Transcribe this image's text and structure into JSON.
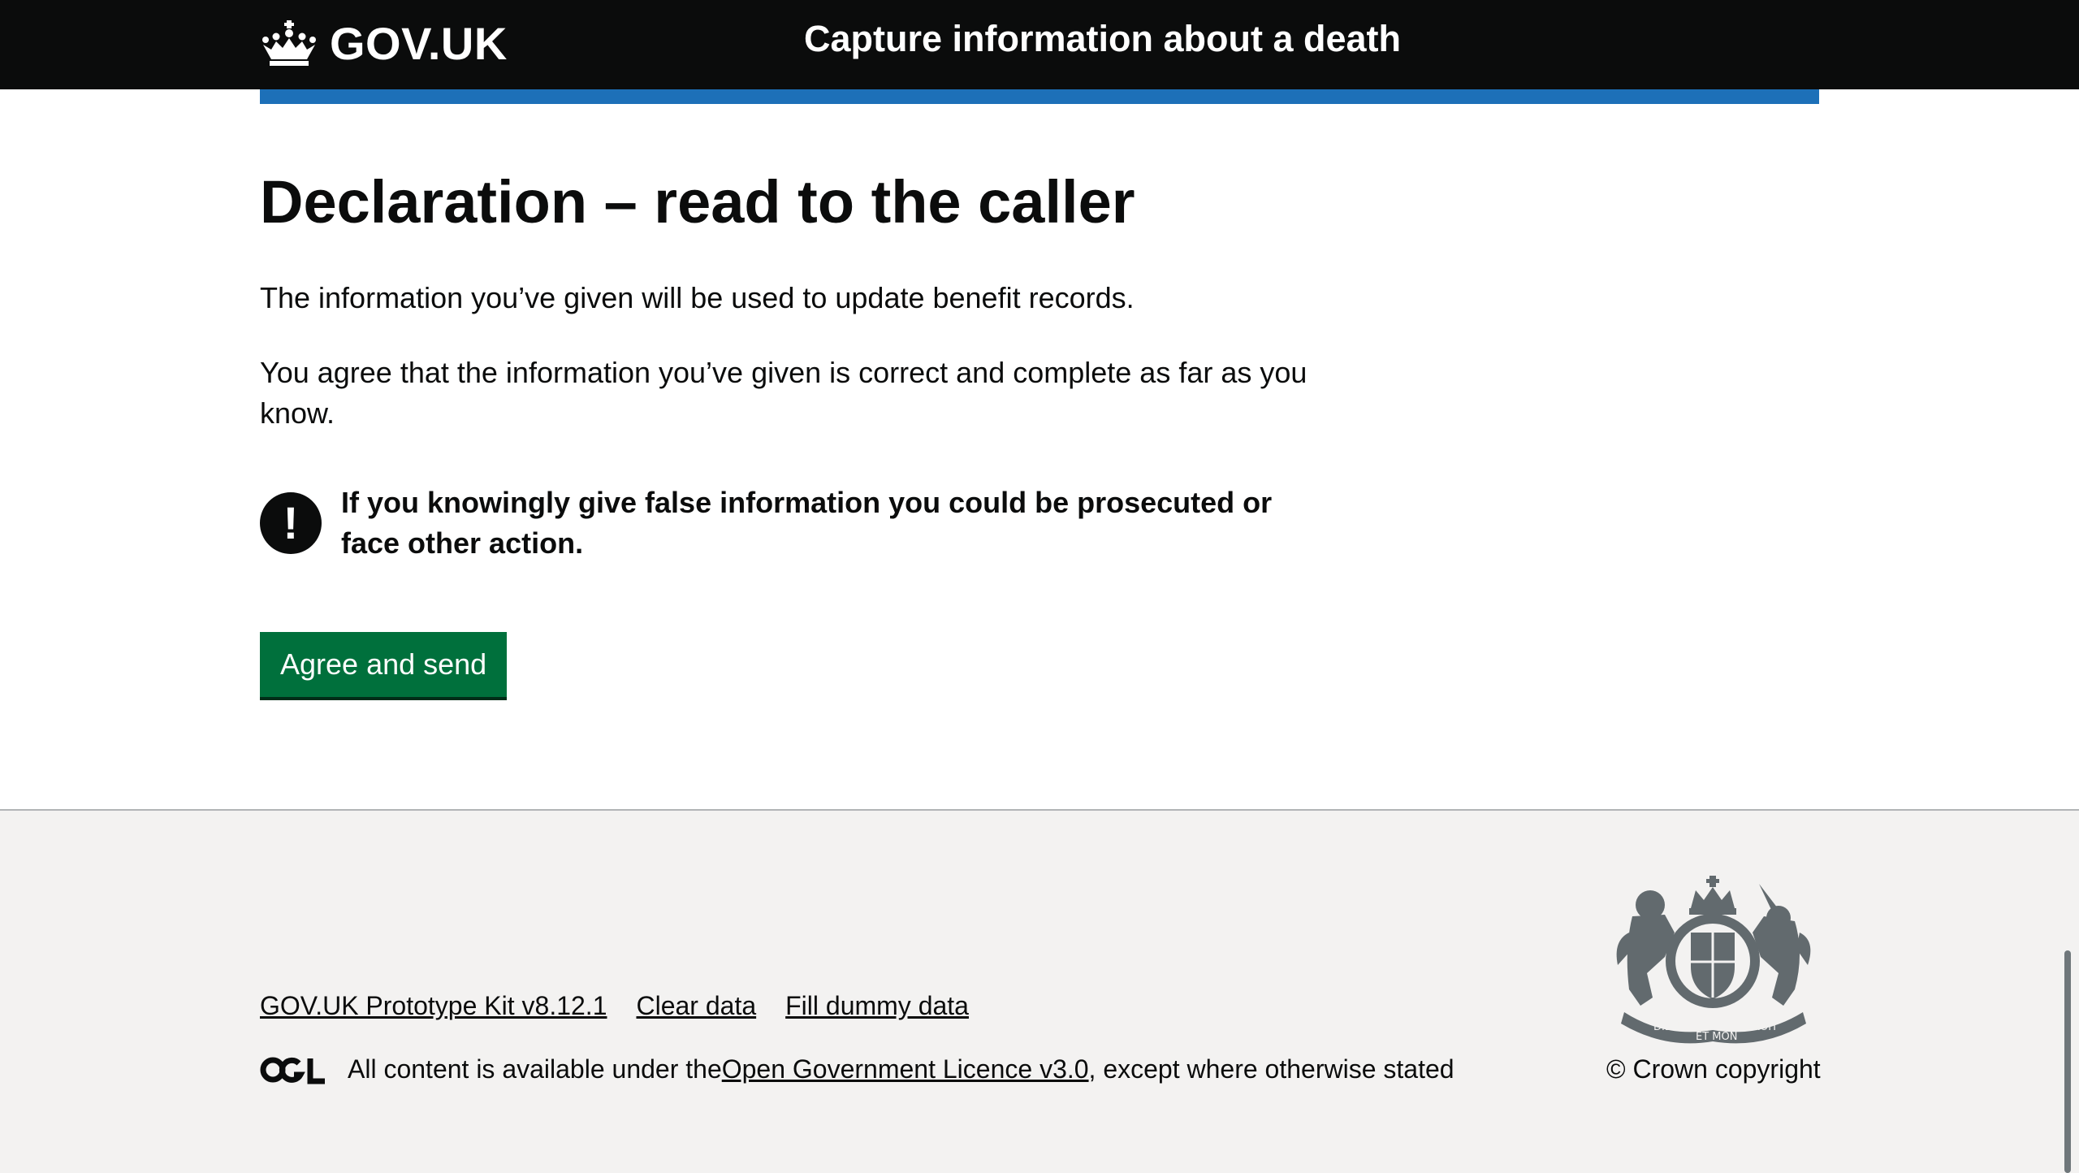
{
  "header": {
    "logo_text": "GOV.UK",
    "service_name": "Capture information about a death"
  },
  "main": {
    "title": "Declaration – read to the caller",
    "paragraph_1": "The information you’ve given will be used to update benefit records.",
    "paragraph_2": "You agree that the information you’ve given is correct and complete as far as you know.",
    "warning_icon": "!",
    "warning_text": "If you knowingly give false information you could be prosecuted or face other action.",
    "submit_label": "Agree and send"
  },
  "footer": {
    "links": [
      "GOV.UK Prototype Kit v8.12.1",
      "Clear data",
      "Fill dummy data"
    ],
    "licence_prefix": "All content is available under the ",
    "licence_link": "Open Government Licence v3.0",
    "licence_suffix": ", except where otherwise stated",
    "copyright": "© Crown copyright",
    "crest_motto_left": "DIEU",
    "crest_motto_center": "ET MON",
    "crest_motto_right": "DROIT"
  },
  "colors": {
    "header_bg": "#0b0c0c",
    "accent_blue": "#1d70b8",
    "button_green": "#00703c",
    "footer_bg": "#f3f2f1"
  }
}
